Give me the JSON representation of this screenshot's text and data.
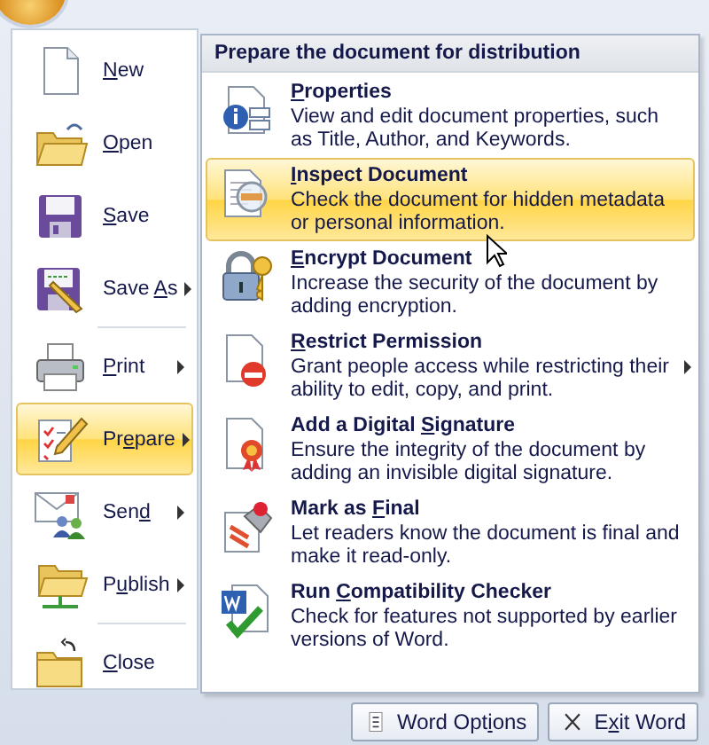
{
  "commands": [
    {
      "label": {
        "key": "N",
        "post": "ew"
      },
      "submenu": false,
      "selected": false,
      "separator_after": false
    },
    {
      "label": {
        "key": "O",
        "post": "pen"
      },
      "submenu": false,
      "selected": false,
      "separator_after": false
    },
    {
      "label": {
        "key": "S",
        "post": "ave"
      },
      "submenu": false,
      "selected": false,
      "separator_after": false
    },
    {
      "label": {
        "pre": "Save ",
        "key": "A",
        "post": "s"
      },
      "submenu": true,
      "selected": false,
      "separator_after": true
    },
    {
      "label": {
        "key": "P",
        "post": "rint"
      },
      "submenu": true,
      "selected": false,
      "separator_after": false
    },
    {
      "label": {
        "pre": "Pr",
        "key": "e",
        "post": "pare"
      },
      "submenu": true,
      "selected": true,
      "separator_after": false
    },
    {
      "label": {
        "pre": "Sen",
        "key": "d"
      },
      "submenu": true,
      "selected": false,
      "separator_after": false
    },
    {
      "label": {
        "pre": "P",
        "key": "u",
        "post": "blish"
      },
      "submenu": true,
      "selected": false,
      "separator_after": true
    },
    {
      "label": {
        "key": "C",
        "post": "lose"
      },
      "submenu": false,
      "selected": false,
      "separator_after": false
    }
  ],
  "prepare_panel": {
    "heading": "Prepare the document for distribution",
    "items": [
      {
        "title": {
          "key": "P",
          "post": "roperties"
        },
        "description": "View and edit document properties, such as Title, Author, and Keywords.",
        "submenu": false,
        "selected": false
      },
      {
        "title": {
          "key": "I",
          "post": "nspect Document"
        },
        "description": "Check the document for hidden metadata or personal information.",
        "submenu": false,
        "selected": true
      },
      {
        "title": {
          "key": "E",
          "post": "ncrypt Document"
        },
        "description": "Increase the security of the document by adding encryption.",
        "submenu": false,
        "selected": false
      },
      {
        "title": {
          "key": "R",
          "post": "estrict Permission"
        },
        "description": "Grant people access while restricting their ability to edit, copy, and print.",
        "submenu": true,
        "selected": false
      },
      {
        "title": {
          "pre": "Add a Digital ",
          "key": "S",
          "post": "ignature"
        },
        "description": "Ensure the integrity of the document by adding an invisible digital signature.",
        "submenu": false,
        "selected": false
      },
      {
        "title": {
          "pre": "Mark as ",
          "key": "F",
          "post": "inal"
        },
        "description": "Let readers know the document is final and make it read-only.",
        "submenu": false,
        "selected": false
      },
      {
        "title": {
          "pre": "Run ",
          "key": "C",
          "post": "ompatibility Checker"
        },
        "description": "Check for features not supported by earlier versions of Word.",
        "submenu": false,
        "selected": false
      }
    ]
  },
  "footer_buttons": [
    {
      "label": {
        "pre": "Word Opt",
        "key": "i",
        "post": "ons"
      }
    },
    {
      "label": {
        "pre": "E",
        "key": "x",
        "post": "it Word"
      }
    }
  ]
}
